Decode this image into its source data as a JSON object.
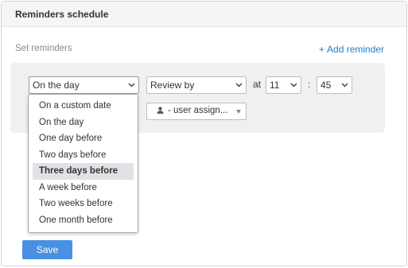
{
  "panel": {
    "title": "Reminders schedule"
  },
  "section": {
    "label": "Set reminders",
    "add_link": {
      "plus": "+",
      "label": "Add reminder"
    }
  },
  "reminder": {
    "when_value": "On the day",
    "action_value": "Review by",
    "at_label": "at",
    "hour_value": "11",
    "colon": ":",
    "minute_value": "45",
    "user_value": "- user assign..."
  },
  "dropdown": {
    "options": [
      "On a custom date",
      "On the day",
      "One day before",
      "Two days before",
      "Three days before",
      "A week before",
      "Two weeks before",
      "One month before"
    ],
    "highlighted": "Three days before"
  },
  "footer": {
    "save_label": "Save"
  },
  "colors": {
    "accent": "#1a82c9",
    "button": "#4a90e2",
    "box_bg": "#f0f0f0",
    "highlight": "#e1e1e6"
  },
  "icons": {
    "select_chevron": "chevron-down-icon",
    "user": "person-icon",
    "user_select_caret": "caret-down-icon"
  }
}
